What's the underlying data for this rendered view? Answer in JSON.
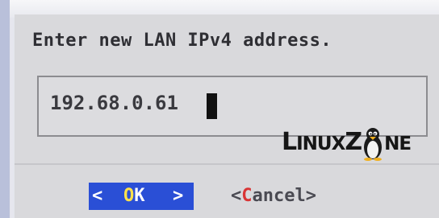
{
  "dialog": {
    "prompt": "Enter new LAN IPv4 address.",
    "input_value": "192.68.0.61"
  },
  "buttons": {
    "ok": {
      "left_bracket": "<",
      "hotkey": "O",
      "rest": "K",
      "right_bracket": ">"
    },
    "cancel": {
      "open": "<",
      "hotkey": "C",
      "rest": "ancel",
      "close": ">"
    }
  },
  "watermark": {
    "part1_big": "L",
    "part1_small": "INUX",
    "part2_big": "Z",
    "part3_small": "NE"
  },
  "colors": {
    "dialog_bg": "#d9d9dc",
    "ok_bg": "#2a4fd6",
    "hotkey_red": "#d93535",
    "hotkey_yellow": "#ffe24a"
  },
  "icons": [
    "penguin-icon"
  ]
}
